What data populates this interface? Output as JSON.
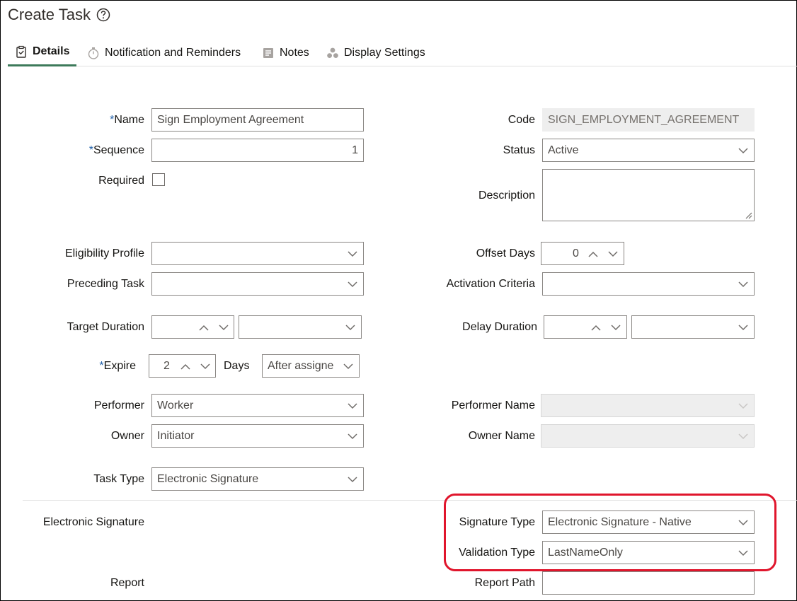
{
  "page": {
    "title": "Create Task"
  },
  "tabs": [
    {
      "label": "Details"
    },
    {
      "label": "Notification and Reminders"
    },
    {
      "label": "Notes"
    },
    {
      "label": "Display Settings"
    }
  ],
  "form": {
    "name": {
      "label": "Name",
      "required_mark": "*",
      "value": "Sign Employment Agreement"
    },
    "sequence": {
      "label": "Sequence",
      "required_mark": "*",
      "value": "1"
    },
    "required": {
      "label": "Required",
      "checked": false
    },
    "code": {
      "label": "Code",
      "value": "SIGN_EMPLOYMENT_AGREEMENT"
    },
    "status": {
      "label": "Status",
      "value": "Active"
    },
    "description": {
      "label": "Description",
      "value": ""
    },
    "eligibility_profile": {
      "label": "Eligibility Profile",
      "value": ""
    },
    "offset_days": {
      "label": "Offset Days",
      "value": "0"
    },
    "preceding_task": {
      "label": "Preceding Task",
      "value": ""
    },
    "activation_criteria": {
      "label": "Activation Criteria",
      "value": ""
    },
    "target_duration": {
      "label": "Target Duration",
      "value": "",
      "unit": ""
    },
    "delay_duration": {
      "label": "Delay Duration",
      "value": "",
      "unit": ""
    },
    "expire": {
      "label": "Expire",
      "required_mark": "*",
      "value": "2",
      "unit_label": "Days",
      "when": "After assigne"
    },
    "performer": {
      "label": "Performer",
      "value": "Worker"
    },
    "performer_name": {
      "label": "Performer Name",
      "value": ""
    },
    "owner": {
      "label": "Owner",
      "value": "Initiator"
    },
    "owner_name": {
      "label": "Owner Name",
      "value": ""
    },
    "task_type": {
      "label": "Task Type",
      "value": "Electronic Signature"
    },
    "esig_section": {
      "label": "Electronic Signature"
    },
    "signature_type": {
      "label": "Signature Type",
      "value": "Electronic Signature - Native"
    },
    "validation_type": {
      "label": "Validation Type",
      "value": "LastNameOnly"
    },
    "report": {
      "label": "Report"
    },
    "report_path": {
      "label": "Report Path",
      "value": ""
    }
  },
  "colors": {
    "tab_underline": "#3d7a5a",
    "required_star": "#1f5fa8",
    "highlight": "#e0152c"
  }
}
